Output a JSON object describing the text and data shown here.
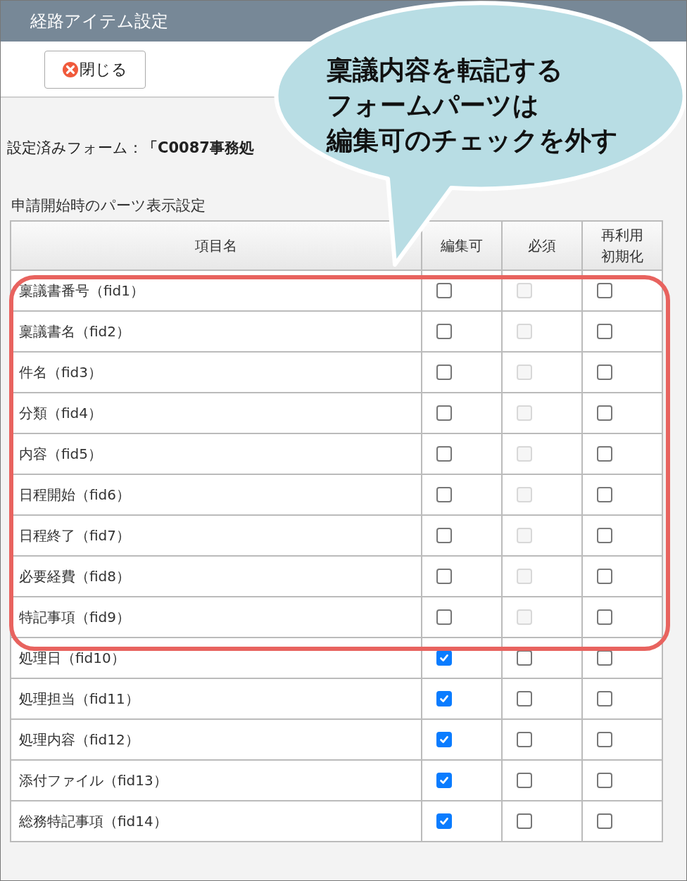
{
  "window": {
    "title": "経路アイテム設定"
  },
  "toolbar": {
    "close_button": "閉じる"
  },
  "form_label": "設定済みフォーム：**「C0087事務処**",
  "section_title": "申請開始時のパーツ表示設定",
  "table": {
    "columns": [
      "項目名",
      "編集可",
      "必須",
      "再利用初期化"
    ],
    "rows": [
      {
        "name": "稟議書番号（fid1）",
        "editable": {
          "checked": false,
          "disabled": false
        },
        "required": {
          "checked": false,
          "disabled": true
        },
        "reset": {
          "checked": false,
          "disabled": false
        }
      },
      {
        "name": "稟議書名（fid2）",
        "editable": {
          "checked": false,
          "disabled": false
        },
        "required": {
          "checked": false,
          "disabled": true
        },
        "reset": {
          "checked": false,
          "disabled": false
        }
      },
      {
        "name": "件名（fid3）",
        "editable": {
          "checked": false,
          "disabled": false
        },
        "required": {
          "checked": false,
          "disabled": true
        },
        "reset": {
          "checked": false,
          "disabled": false
        }
      },
      {
        "name": "分類（fid4）",
        "editable": {
          "checked": false,
          "disabled": false
        },
        "required": {
          "checked": false,
          "disabled": true
        },
        "reset": {
          "checked": false,
          "disabled": false
        }
      },
      {
        "name": "内容（fid5）",
        "editable": {
          "checked": false,
          "disabled": false
        },
        "required": {
          "checked": false,
          "disabled": true
        },
        "reset": {
          "checked": false,
          "disabled": false
        }
      },
      {
        "name": "日程開始（fid6）",
        "editable": {
          "checked": false,
          "disabled": false
        },
        "required": {
          "checked": false,
          "disabled": true
        },
        "reset": {
          "checked": false,
          "disabled": false
        }
      },
      {
        "name": "日程終了（fid7）",
        "editable": {
          "checked": false,
          "disabled": false
        },
        "required": {
          "checked": false,
          "disabled": true
        },
        "reset": {
          "checked": false,
          "disabled": false
        }
      },
      {
        "name": "必要経費（fid8）",
        "editable": {
          "checked": false,
          "disabled": false
        },
        "required": {
          "checked": false,
          "disabled": true
        },
        "reset": {
          "checked": false,
          "disabled": false
        }
      },
      {
        "name": "特記事項（fid9）",
        "editable": {
          "checked": false,
          "disabled": false
        },
        "required": {
          "checked": false,
          "disabled": true
        },
        "reset": {
          "checked": false,
          "disabled": false
        }
      },
      {
        "name": "処理日（fid10）",
        "editable": {
          "checked": true,
          "disabled": false
        },
        "required": {
          "checked": false,
          "disabled": false
        },
        "reset": {
          "checked": false,
          "disabled": false
        }
      },
      {
        "name": "処理担当（fid11）",
        "editable": {
          "checked": true,
          "disabled": false
        },
        "required": {
          "checked": false,
          "disabled": false
        },
        "reset": {
          "checked": false,
          "disabled": false
        }
      },
      {
        "name": "処理内容（fid12）",
        "editable": {
          "checked": true,
          "disabled": false
        },
        "required": {
          "checked": false,
          "disabled": false
        },
        "reset": {
          "checked": false,
          "disabled": false
        }
      },
      {
        "name": "添付ファイル（fid13）",
        "editable": {
          "checked": true,
          "disabled": false
        },
        "required": {
          "checked": false,
          "disabled": false
        },
        "reset": {
          "checked": false,
          "disabled": false
        }
      },
      {
        "name": "総務特記事項（fid14）",
        "editable": {
          "checked": true,
          "disabled": false
        },
        "required": {
          "checked": false,
          "disabled": false
        },
        "reset": {
          "checked": false,
          "disabled": false
        }
      }
    ]
  },
  "callout": {
    "lines": [
      "稟議内容を転記する",
      "フォームパーツは",
      "編集可のチェックを外す"
    ]
  }
}
